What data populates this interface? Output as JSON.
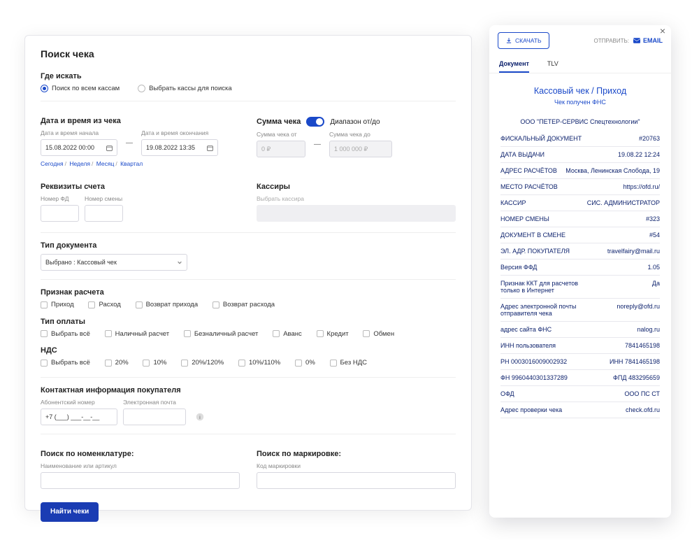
{
  "form": {
    "title": "Поиск чека",
    "where": {
      "title": "Где искать",
      "opt1": "Поиск по всем кассам",
      "opt2": "Выбрать кассы для поиска"
    },
    "datetime": {
      "title": "Дата и время из чека",
      "from_label": "Дата и время начала",
      "to_label": "Дата и время окончания",
      "from": "15.08.2022 00:00",
      "to": "19.08.2022 13:35",
      "today": "Сегодня",
      "week": "Неделя",
      "month": "Месяц",
      "quarter": "Квартал"
    },
    "sum": {
      "title": "Сумма чека",
      "range": "Диапазон от/до",
      "from_label": "Сумма чека от",
      "to_label": "Сумма чека до",
      "from": "0 ₽",
      "to": "1 000 000 ₽"
    },
    "account": {
      "title": "Реквизиты счета",
      "fd_label": "Номер ФД",
      "shift_label": "Номер смены"
    },
    "cashier": {
      "title": "Кассиры",
      "hint": "Выбрать кассира",
      "btn": ""
    },
    "doctype": {
      "title": "Тип документа",
      "value": "Выбрано : Кассовый чек"
    },
    "calc": {
      "title": "Признак расчета",
      "c1": "Приход",
      "c2": "Расход",
      "c3": "Возврат прихода",
      "c4": "Возврат расхода"
    },
    "pay": {
      "title": "Тип оплаты",
      "p1": "Выбрать всё",
      "p2": "Наличный расчет",
      "p3": "Безналичный расчет",
      "p4": "Аванс",
      "p5": "Кредит",
      "p6": "Обмен"
    },
    "vat": {
      "title": "НДС",
      "v1": "Выбрать всё",
      "v2": "20%",
      "v3": "10%",
      "v4": "20%/120%",
      "v5": "10%/110%",
      "v6": "0%",
      "v7": "Без НДС"
    },
    "contact": {
      "title": "Контактная информация покупателя",
      "phone_label": "Абонентский номер",
      "phone_value": "+7 (___) ___-__-__",
      "email_label": "Электронная почта"
    },
    "nomen": {
      "title": "Поиск по номенклатуре:",
      "hint": "Наименование или артикул"
    },
    "mark": {
      "title": "Поиск по маркировке:",
      "hint": "Код маркировки"
    },
    "submit": "Найти чеки"
  },
  "receipt": {
    "download": "СКАЧАТЬ",
    "send": "ОТПРАВИТЬ:",
    "email": "EMAIL",
    "tabs": {
      "doc": "Документ",
      "tlv": "TLV"
    },
    "title": "Кассовый чек / Приход",
    "subtitle": "Чек получен ФНС",
    "org": "ООО \"ПЕТЕР-СЕРВИС Спецтехнологии\"",
    "rows": [
      {
        "k": "ФИСКАЛЬНЫЙ ДОКУМЕНТ",
        "v": "#20763"
      },
      {
        "k": "ДАТА ВЫДАЧИ",
        "v": "19.08.22 12:24"
      },
      {
        "k": "АДРЕС РАСЧЁТОВ",
        "v": "Москва, Ленинская Слобода, 19"
      },
      {
        "k": "МЕСТО РАСЧЁТОВ",
        "v": "https://ofd.ru/"
      },
      {
        "k": "КАССИР",
        "v": "СИС. АДМИНИСТРАТОР"
      },
      {
        "k": "НОМЕР СМЕНЫ",
        "v": "#323"
      },
      {
        "k": "ДОКУМЕНТ В СМЕНЕ",
        "v": "#54"
      },
      {
        "k": "ЭЛ. АДР. ПОКУПАТЕЛЯ",
        "v": "travelfairy@mail.ru"
      },
      {
        "k": "Версия ФФД",
        "v": "1.05"
      },
      {
        "k": "Признак ККТ для расчетов только в Интернет",
        "v": "Да"
      },
      {
        "k": "Адрес электронной почты отправителя чека",
        "v": "noreply@ofd.ru"
      },
      {
        "k": "адрес сайта ФНС",
        "v": "nalog.ru"
      },
      {
        "k": "ИНН пользователя",
        "v": "7841465198"
      },
      {
        "k": "РН 0003016009002932",
        "v": "ИНН 7841465198"
      },
      {
        "k": "ФН 9960440301337289",
        "v": "ФПД 483295659"
      },
      {
        "k": "ОФД",
        "v": "ООО ПС СТ"
      },
      {
        "k": "Адрес проверки чека",
        "v": "check.ofd.ru"
      }
    ]
  }
}
